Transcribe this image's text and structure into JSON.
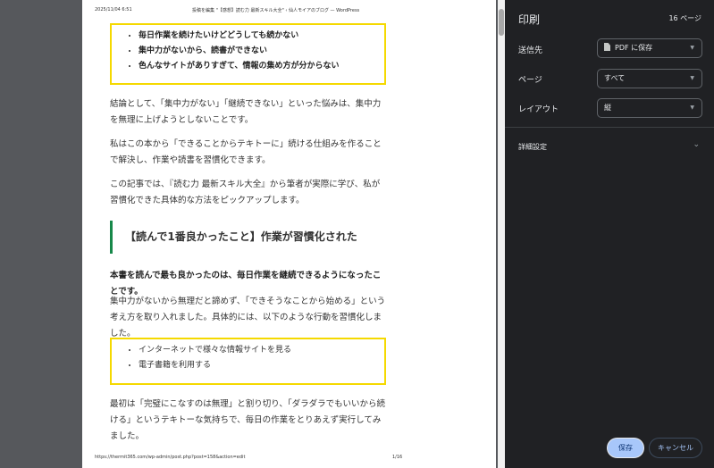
{
  "page_header": {
    "datetime": "2025/11/04 6:51",
    "doc_title": "投稿を編集 \"【感想】読む力 最新スキル大全\" ‹ 仙人モイアのブログ — WordPress"
  },
  "page_footer": {
    "url": "https://thermit365.com/wp-admin/post.php?post=158&action=edit",
    "page_number": "1/16"
  },
  "content": {
    "list1": [
      "毎日作業を続けたいけどどうしても続かない",
      "集中力がないから、読書ができない",
      "色んなサイトがありすぎて、情報の集め方が分からない"
    ],
    "para1": "結論として、「集中力がない」「継続できない」といった悩みは、集中力を無理に上げようとしないことです。",
    "para2": "私はこの本から「できることからテキトーに」続ける仕組みを作ることで解決し、作業や読書を習慣化できます。",
    "para3": "この記事では、『読む力 最新スキル大全』から筆者が実際に学び、私が習慣化できた具体的な方法をピックアップします。",
    "heading": "【読んで1番良かったこと】作業が習慣化された",
    "para4": "本書を読んで最も良かったのは、毎日作業を継続できるようになったことです。",
    "para5": "集中力がないから無理だと諦めず、「できそうなことから始める」という考え方を取り入れました。具体的には、以下のような行動を習慣化しました。",
    "list2": [
      "インターネットで様々な情報サイトを見る",
      "電子書籍を利用する"
    ],
    "para6": "最初は「完璧にこなすのは無理」と割り切り、「ダラダラでもいいから続ける」というテキトーな気持ちで、毎日の作業をとりあえず実行してみました。"
  },
  "panel": {
    "title": "印刷",
    "page_count": "16 ページ",
    "destination_label": "送信先",
    "destination_value": "PDF に保存",
    "pages_label": "ページ",
    "pages_value": "すべて",
    "layout_label": "レイアウト",
    "layout_value": "縦",
    "more_settings": "詳細設定",
    "save": "保存",
    "cancel": "キャンセル"
  },
  "colors": {
    "accent_box": "#f5d900",
    "heading_bar": "#17884a",
    "panel_bg": "#202124",
    "save_bg": "#a8c7fa"
  }
}
